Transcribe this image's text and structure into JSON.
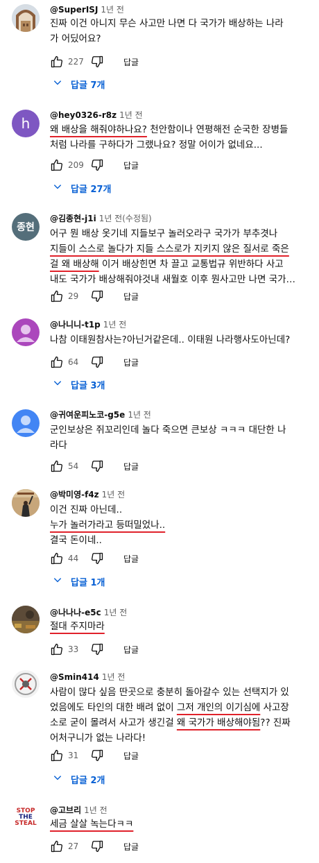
{
  "comments": [
    {
      "author": "@SuperISJ",
      "time": "1년 전",
      "lines": [
        [
          "진짜 이건 아니지 무슨 사고만 나면 다 국가가 배상하는 나라"
        ],
        [
          "가 어딨어요?"
        ]
      ],
      "likes": "227",
      "reply_label": "답글",
      "replies_label": "답글 7개"
    },
    {
      "author": "@hey0326-r8z",
      "time": "1년 전",
      "avatar_letter": "h",
      "lines": [
        [
          "@u:왜 배상을 해줘야하나요?",
          " 천안함이나 연평해전 순국한 장병들"
        ],
        [
          "처럼 나라를 구하다가 그랬나요? 정말 어이가 없네요..."
        ]
      ],
      "likes": "209",
      "reply_label": "답글",
      "replies_label": "답글 27개"
    },
    {
      "author": "@김종현-j1i",
      "time": "1년 전(수정됨)",
      "avatar_letter": "종현",
      "lines": [
        [
          "어구 뭔 배상 옷기네 지들보구 놀러오라구 국가가  부추겻나"
        ],
        [
          "@u:지들이 스스로 놀다가 지들 스스로가 지키지 않은 질서로 죽은"
        ],
        [
          "@u:걸 왜 배상해",
          " 이거 배상힌면 차 끌고 교통법규 위반하다 사고"
        ],
        [
          "내도 국가가 배상해줘야것내 새월호 이후 뭔사고만 나면 국가…"
        ]
      ],
      "likes": "29",
      "reply_label": "답글"
    },
    {
      "author": "@나니니-t1p",
      "time": "1년 전",
      "lines": [
        [
          "나참 이태원참사는?아닌거같은데.. 이태원 나라행사도아닌데?"
        ]
      ],
      "likes": "64",
      "reply_label": "답글",
      "replies_label": "답글 3개"
    },
    {
      "author": "@귀여운피노코-g5e",
      "time": "1년 전",
      "lines": [
        [
          "군인보상은 쥐꼬리인데 놀다 죽으면 큰보상 ㅋㅋㅋ 대단한 나"
        ],
        [
          "라다"
        ]
      ],
      "likes": "54",
      "reply_label": "답글"
    },
    {
      "author": "@박미영-f4z",
      "time": "1년 전",
      "lines": [
        [
          "이건 진짜 아닌데.."
        ],
        [
          "@u:누가 놀러가라고 등떠밀었나.."
        ],
        [
          "결국 돈이네.."
        ]
      ],
      "likes": "44",
      "reply_label": "답글",
      "replies_label": "답글 1개"
    },
    {
      "author": "@나나나-e5c",
      "time": "1년 전",
      "lines": [
        [
          "@u:절대 주지마라"
        ]
      ],
      "likes": "33",
      "reply_label": "답글"
    },
    {
      "author": "@Smin414",
      "time": "1년 전",
      "lines": [
        [
          "사람이 많다 싶음 딴곳으로 충분히 돌아갈수 있는 선택지가 있"
        ],
        [
          "었음에도 타인의 대한 배려 없이 ",
          "@u:그저 개인의 이기심에",
          " 사고장"
        ],
        [
          "소로 굳이 몰려서 사고가 생긴걸 ",
          "@u:왜 국가가 배상해야됨",
          "?? 진짜"
        ],
        [
          "어처구니가 없는 나라다!"
        ]
      ],
      "likes": "31",
      "reply_label": "답글",
      "replies_label": "답글 2개"
    },
    {
      "author": "@고브리",
      "time": "1년 전",
      "avatar_text": [
        "STOP",
        "THE",
        "STEAL"
      ],
      "lines": [
        [
          "@u:세금 살살 녹는다ㅋㅋ"
        ]
      ],
      "likes": "27",
      "reply_label": "답글"
    }
  ],
  "colors": {
    "underline": "#e0212a",
    "link": "#065fd4",
    "meta": "#606060"
  }
}
